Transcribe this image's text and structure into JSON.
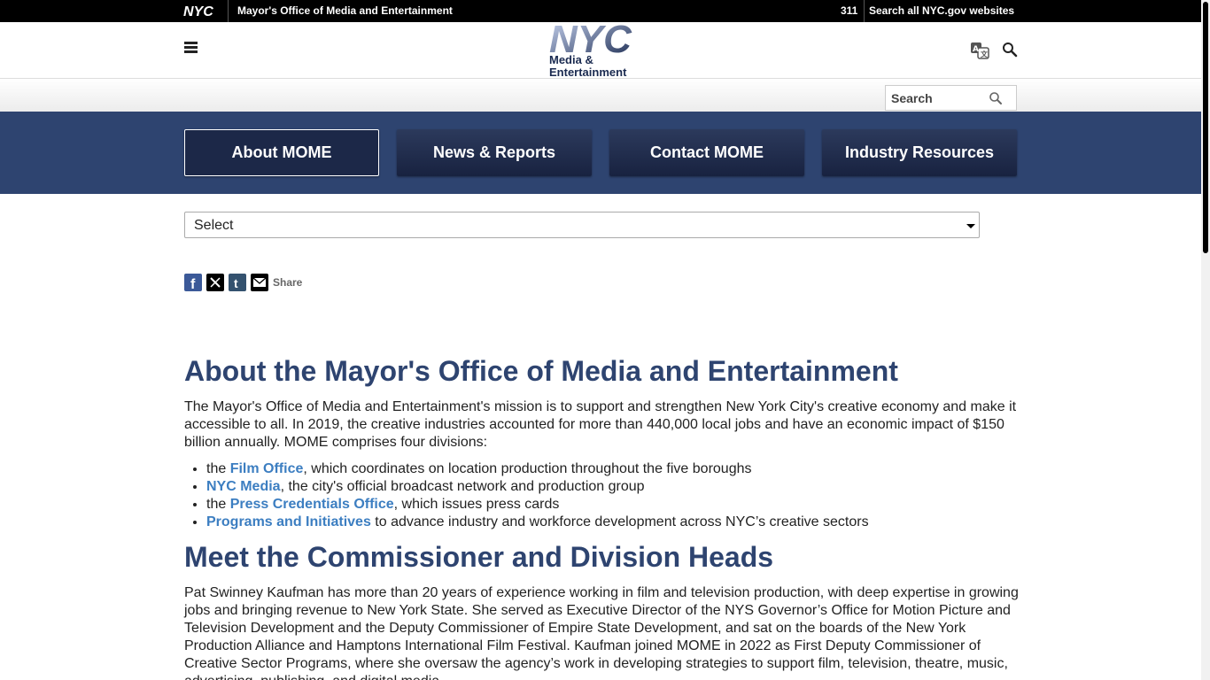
{
  "topbar": {
    "logo_text": "NYC",
    "agency_link": "Mayor's Office of Media and Entertainment",
    "link_311": "311",
    "search_all": "Search all NYC.gov websites"
  },
  "header": {
    "brand_logo": "NYC",
    "brand_sub_line1": "Media &",
    "brand_sub_line2": "Entertainment",
    "menu_icon": "hamburger-icon",
    "translate_icon": "translate-icon",
    "search_icon": "search-icon"
  },
  "search": {
    "placeholder": "Search"
  },
  "nav": {
    "items": [
      {
        "label": "About MOME",
        "active": true
      },
      {
        "label": "News & Reports",
        "active": false
      },
      {
        "label": "Contact MOME",
        "active": false
      },
      {
        "label": "Industry Resources",
        "active": false
      }
    ]
  },
  "select": {
    "value": "Select"
  },
  "share": {
    "label": "Share",
    "icons": [
      "facebook-icon",
      "x-icon",
      "tumblr-icon",
      "email-icon"
    ]
  },
  "content": {
    "heading1": "About the Mayor's Office of Media and Entertainment",
    "paragraph1": "The Mayor's Office of Media and Entertainment's mission is to support and strengthen New York City's creative economy and make it accessible to all. In 2019, the creative industries accounted for more than 440,000 local jobs and have an economic impact of $150 billion annually. MOME comprises four divisions:",
    "divisions": [
      {
        "prefix": "the ",
        "link": "Film Office",
        "suffix": ", which coordinates on location production throughout the five boroughs"
      },
      {
        "prefix": "",
        "link": "NYC Media",
        "suffix": ", the city's official broadcast network and production group"
      },
      {
        "prefix": "the ",
        "link": "Press Credentials Office",
        "suffix": ", which issues press cards"
      },
      {
        "prefix": "",
        "link": "Programs and Initiatives",
        "suffix": " to advance industry and workforce development across NYC’s creative sectors"
      }
    ],
    "heading2": "Meet the Commissioner and Division Heads",
    "paragraph2": "Pat Swinney Kaufman has more than 20 years of experience working in film and television production, with deep expertise in growing jobs and bringing revenue to New York State. She served as Executive Director of the NYS Governor’s Office for Motion Picture and Television Development and the Deputy Commissioner of Empire State Development, and sat on the boards of the New York Production Alliance and Hamptons International Film Festival. Kaufman joined MOME in 2022 as First Deputy Commissioner of Creative Sector Programs, where she oversaw the agency’s work in developing strategies to support film, television, theatre, music, advertising, publishing, and digital media."
  },
  "colors": {
    "nav_band": "#2e4470",
    "heading": "#2e4470",
    "link": "#3c7ec1"
  }
}
